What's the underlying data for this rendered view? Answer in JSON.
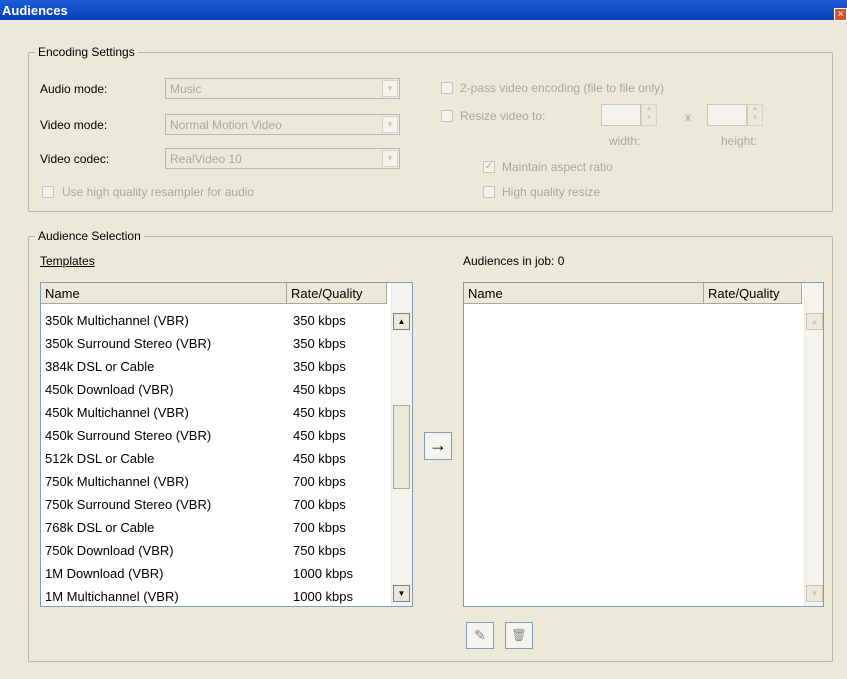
{
  "window": {
    "title": "Audiences",
    "close_glyph": "×"
  },
  "encoding": {
    "group_title": "Encoding Settings",
    "audio_mode": {
      "label": "Audio mode:",
      "value": "Music"
    },
    "video_mode": {
      "label": "Video mode:",
      "value": "Normal Motion Video"
    },
    "video_codec": {
      "label": "Video codec:",
      "value": "RealVideo 10"
    },
    "hq_resampler": {
      "label": "Use high quality resampler for audio",
      "checked": false
    },
    "two_pass": {
      "label": "2-pass video encoding (file to file only)",
      "checked": false
    },
    "resize": {
      "label": "Resize video to:",
      "checked": false,
      "x_sep": "x",
      "width_label": "width:",
      "height_label": "height:"
    },
    "maintain_aspect": {
      "label": "Maintain aspect ratio",
      "checked": true
    },
    "hq_resize": {
      "label": "High quality resize",
      "checked": false
    }
  },
  "audience_selection": {
    "group_title": "Audience Selection",
    "templates_label": "Templates",
    "audiences_label": "Audiences in job: 0",
    "columns": [
      "Name",
      "Rate/Quality"
    ],
    "templates": [
      {
        "name": "350k Multichannel (VBR)",
        "rate": "350 kbps"
      },
      {
        "name": "350k Surround Stereo (VBR)",
        "rate": "350 kbps"
      },
      {
        "name": "384k DSL or Cable",
        "rate": "350 kbps"
      },
      {
        "name": "450k Download (VBR)",
        "rate": "450 kbps"
      },
      {
        "name": "450k Multichannel (VBR)",
        "rate": "450 kbps"
      },
      {
        "name": "450k Surround Stereo (VBR)",
        "rate": "450 kbps"
      },
      {
        "name": "512k DSL or Cable",
        "rate": "450 kbps"
      },
      {
        "name": "750k Multichannel (VBR)",
        "rate": "700 kbps"
      },
      {
        "name": "750k Surround Stereo (VBR)",
        "rate": "700 kbps"
      },
      {
        "name": "768k DSL or Cable",
        "rate": "700 kbps"
      },
      {
        "name": "750k Download (VBR)",
        "rate": "750 kbps"
      },
      {
        "name": "1M Download (VBR)",
        "rate": "1000 kbps"
      },
      {
        "name": "1M Multichannel (VBR)",
        "rate": "1000 kbps"
      }
    ],
    "audiences": [],
    "add_glyph": "→",
    "edit_glyph": "✎",
    "delete_glyph": "🗑",
    "scroll_up_glyph": "▲",
    "scroll_down_glyph": "▼"
  }
}
